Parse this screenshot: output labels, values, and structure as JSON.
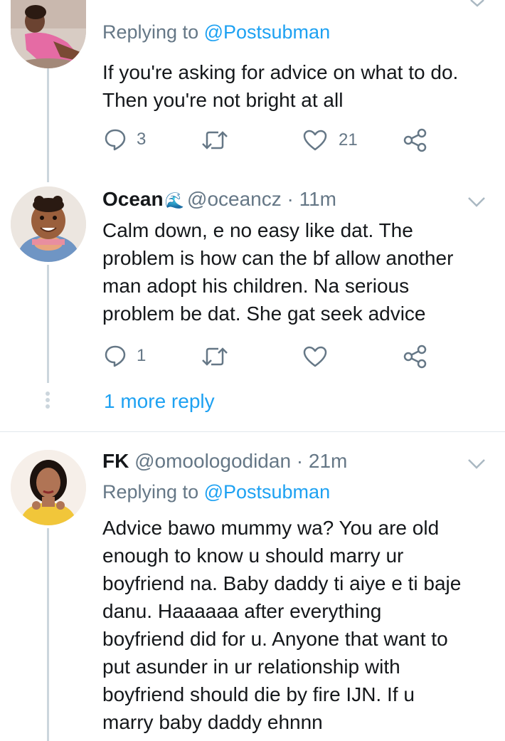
{
  "tweets": [
    {
      "replying_prefix": "Replying to ",
      "replying_handle": "@Postsubman",
      "text_lines": [
        "If you're asking for advice on what to do.",
        "Then you're not bright at all"
      ],
      "reply_count": "3",
      "retweet_count": "",
      "like_count": "21"
    },
    {
      "name": "Ocean",
      "name_emoji": "🌊",
      "handle": "@oceancz",
      "time": " · 11m",
      "text_lines": [
        "Calm down, e no easy like dat. The",
        "problem is how can the bf allow another",
        "man adopt his children. Na serious",
        "problem be dat. She gat seek advice"
      ],
      "reply_count": "1",
      "retweet_count": "",
      "like_count": ""
    },
    {
      "name": "FK",
      "handle": "@omoologodidan",
      "time": " · 21m",
      "replying_prefix": "Replying to ",
      "replying_handle": "@Postsubman",
      "text_lines": [
        "Advice bawo mummy wa? You are old",
        "enough to know u should marry ur",
        "boyfriend na. Baby daddy ti aiye e ti baje",
        "danu. Haaaaaa after everything",
        "boyfriend did for u. Anyone that want to",
        "put asunder in ur relationship with",
        "boyfriend should die by fire IJN. If u",
        "marry baby daddy ehnnn"
      ]
    }
  ],
  "more_reply": "1 more reply",
  "colors": {
    "accent": "#1da1f2",
    "secondary": "#657786",
    "line": "#ccd6dd"
  }
}
